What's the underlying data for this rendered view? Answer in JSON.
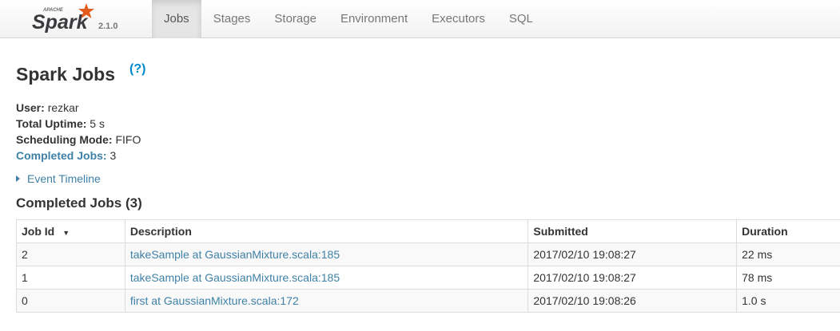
{
  "brand": {
    "name": "Spark",
    "tagline": "APACHE",
    "version": "2.1.0"
  },
  "nav": {
    "tabs": [
      {
        "label": "Jobs"
      },
      {
        "label": "Stages"
      },
      {
        "label": "Storage"
      },
      {
        "label": "Environment"
      },
      {
        "label": "Executors"
      },
      {
        "label": "SQL"
      }
    ],
    "active": "Jobs"
  },
  "page": {
    "title": "Spark Jobs",
    "help": "(?)",
    "summary": {
      "user_label": "User:",
      "user_value": "rezkar",
      "uptime_label": "Total Uptime:",
      "uptime_value": "5 s",
      "mode_label": "Scheduling Mode:",
      "mode_value": "FIFO",
      "completed_label": "Completed Jobs:",
      "completed_value": "3"
    },
    "event_timeline": "Event Timeline",
    "completed_section_title": "Completed Jobs (3)"
  },
  "table": {
    "headers": {
      "job_id": "Job Id",
      "sort_icon": "▼",
      "description": "Description",
      "submitted": "Submitted",
      "duration": "Duration"
    },
    "rows": [
      {
        "job_id": "2",
        "description": "takeSample at GaussianMixture.scala:185",
        "submitted": "2017/02/10 19:08:27",
        "duration": "22 ms"
      },
      {
        "job_id": "1",
        "description": "takeSample at GaussianMixture.scala:185",
        "submitted": "2017/02/10 19:08:27",
        "duration": "78 ms"
      },
      {
        "job_id": "0",
        "description": "first at GaussianMixture.scala:172",
        "submitted": "2017/02/10 19:08:26",
        "duration": "1.0 s"
      }
    ]
  },
  "colors": {
    "link": "#3f81a6",
    "brand_orange": "#e25a1c",
    "nav_active": "#e5e5e5"
  }
}
